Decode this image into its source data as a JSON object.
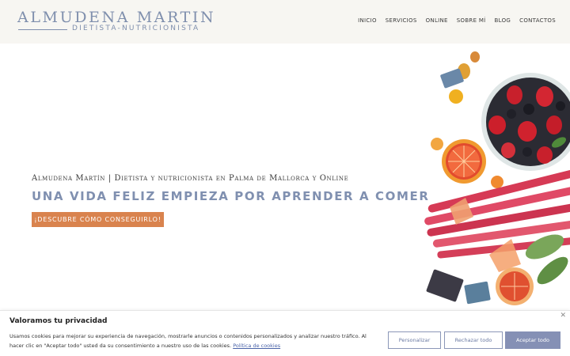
{
  "brand": {
    "name": "ALMUDENA MARTIN",
    "subtitle": "DIETISTA-NUTRICIONISTA",
    "color": "#7f8fad"
  },
  "nav": {
    "items": [
      {
        "label": "INICIO"
      },
      {
        "label": "SERVICIOS"
      },
      {
        "label": "ONLINE"
      },
      {
        "label": "SOBRE MÍ"
      },
      {
        "label": "BLOG"
      },
      {
        "label": "CONTACTOS"
      }
    ]
  },
  "hero": {
    "tagline": "Almudena Martín | Dietista y nutricionista en Palma de Mallorca y Online",
    "heading": "UNA VIDA FELIZ EMPIEZA POR APRENDER A COMER",
    "cta_label": "¡DESCUBRE CÓMO CONSEGUIRLO!",
    "cta_color": "#d9834e",
    "image": "fruit-bowl-photo"
  },
  "cookie_banner": {
    "title": "Valoramos tu privacidad",
    "text": "Usamos cookies para mejorar su experiencia de navegación, mostrarle anuncios o contenidos personalizados y analizar nuestro tráfico. Al hacer clic en \"Aceptar todo\" usted da su consentimiento a nuestro uso de las cookies.",
    "link_label": "Política de cookies",
    "close_icon": "close-icon",
    "buttons": {
      "customize": "Personalizar",
      "reject": "Rechazar todo",
      "accept": "Aceptar todo"
    },
    "accent_color": "#8590b5"
  }
}
